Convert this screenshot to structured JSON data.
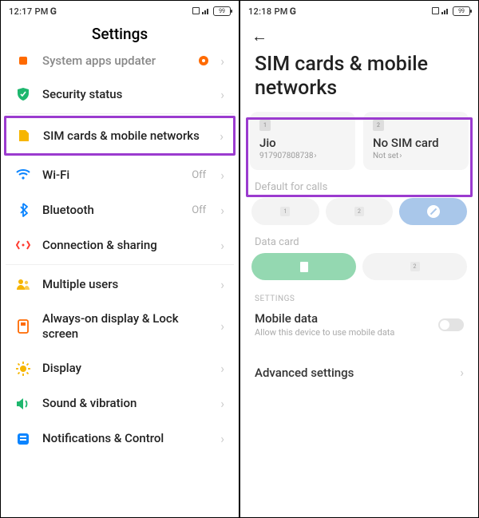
{
  "left": {
    "statusbar": {
      "time": "12:17 PM",
      "battery": "99"
    },
    "title": "Settings",
    "items": [
      {
        "icon": "system-updater-icon",
        "label": "System apps updater",
        "value": "",
        "badge": true
      },
      {
        "icon": "shield-icon",
        "label": "Security status",
        "value": ""
      },
      {
        "icon": "sim-icon",
        "label": "SIM cards & mobile networks",
        "value": "",
        "highlight": true
      },
      {
        "icon": "wifi-icon",
        "label": "Wi-Fi",
        "value": "Off"
      },
      {
        "icon": "bluetooth-icon",
        "label": "Bluetooth",
        "value": "Off"
      },
      {
        "icon": "connection-icon",
        "label": "Connection & sharing",
        "value": ""
      },
      {
        "icon": "users-icon",
        "label": "Multiple users",
        "value": ""
      },
      {
        "icon": "aod-icon",
        "label": "Always-on display & Lock screen",
        "value": ""
      },
      {
        "icon": "display-icon",
        "label": "Display",
        "value": ""
      },
      {
        "icon": "sound-icon",
        "label": "Sound & vibration",
        "value": ""
      },
      {
        "icon": "notifications-icon",
        "label": "Notifications & Control",
        "value": ""
      }
    ]
  },
  "right": {
    "statusbar": {
      "time": "12:18 PM",
      "battery": "99"
    },
    "title": "SIM cards & mobile networks",
    "sims": [
      {
        "slot": "1",
        "name": "Jio",
        "sub": "917907808738"
      },
      {
        "slot": "2",
        "name": "No SIM card",
        "sub": "Not set"
      }
    ],
    "default_calls_label": "Default for calls",
    "call_pills": [
      "1",
      "2",
      "ban"
    ],
    "data_card_label": "Data card",
    "data_pills": [
      "doc",
      "2"
    ],
    "settings_caption": "SETTINGS",
    "mobile_data": {
      "title": "Mobile data",
      "sub": "Allow this device to use mobile data"
    },
    "advanced": "Advanced settings"
  }
}
